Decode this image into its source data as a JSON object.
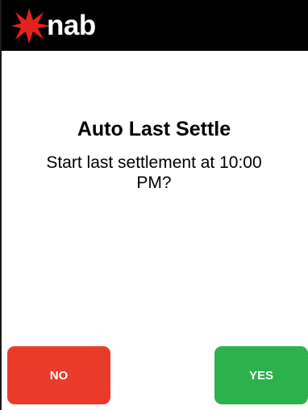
{
  "header": {
    "brand": "nab",
    "logo_icon": "nab-star-icon",
    "background_color": "#000000",
    "logo_color": "#e2231a"
  },
  "dialog": {
    "title": "Auto Last Settle",
    "message": "Start last settlement at 10:00 PM?"
  },
  "buttons": {
    "no_label": "NO",
    "yes_label": "YES",
    "no_color": "#ea3b2a",
    "yes_color": "#2bb24c"
  }
}
